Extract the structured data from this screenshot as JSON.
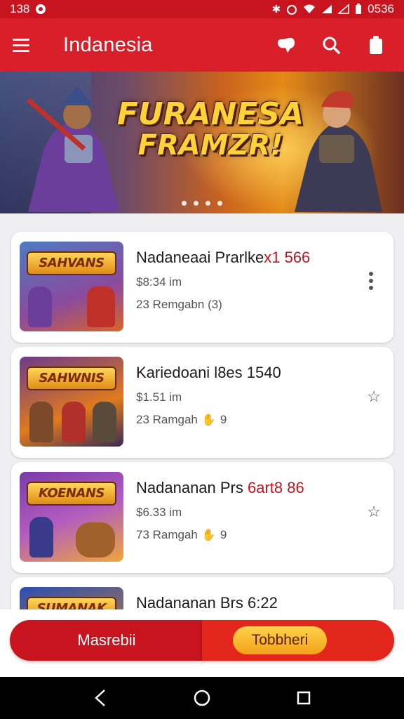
{
  "status_bar": {
    "time": "138",
    "battery": "0536"
  },
  "app_bar": {
    "title": "Indanesia"
  },
  "banner": {
    "title_line1": "FURANESA",
    "title_line2": "FRAMZR!",
    "page_count": 4
  },
  "games": [
    {
      "title": "Nadaneaai Prarlke",
      "title_accent": "x1 566",
      "price": "$8:34  im",
      "reviews": "23  Remgabn (3)",
      "thumb_text": "SAHVANS",
      "action": "more"
    },
    {
      "title": "Kariedoani l8es 1540",
      "title_accent": "",
      "price": "$1.51  im",
      "reviews": "23  Ramgah",
      "reviews_suffix": "9",
      "thumb_text": "SAHWNIS",
      "action": "star"
    },
    {
      "title": "Nadananan Prs ",
      "title_accent": "6art8 86",
      "price": "$6.33  im",
      "reviews": "73  Ramgah",
      "reviews_suffix": "9",
      "thumb_text": "KOENANS",
      "action": "star"
    },
    {
      "title": "Nadananan Brs 6:22",
      "title_accent": "",
      "thumb_text": "SUMANAK"
    }
  ],
  "buttons": {
    "left": "Masrebii",
    "right": "Tobbheri"
  },
  "colors": {
    "primary": "#d9202a",
    "status_bar": "#c8141e",
    "accent_gold": "#ffd23a"
  }
}
